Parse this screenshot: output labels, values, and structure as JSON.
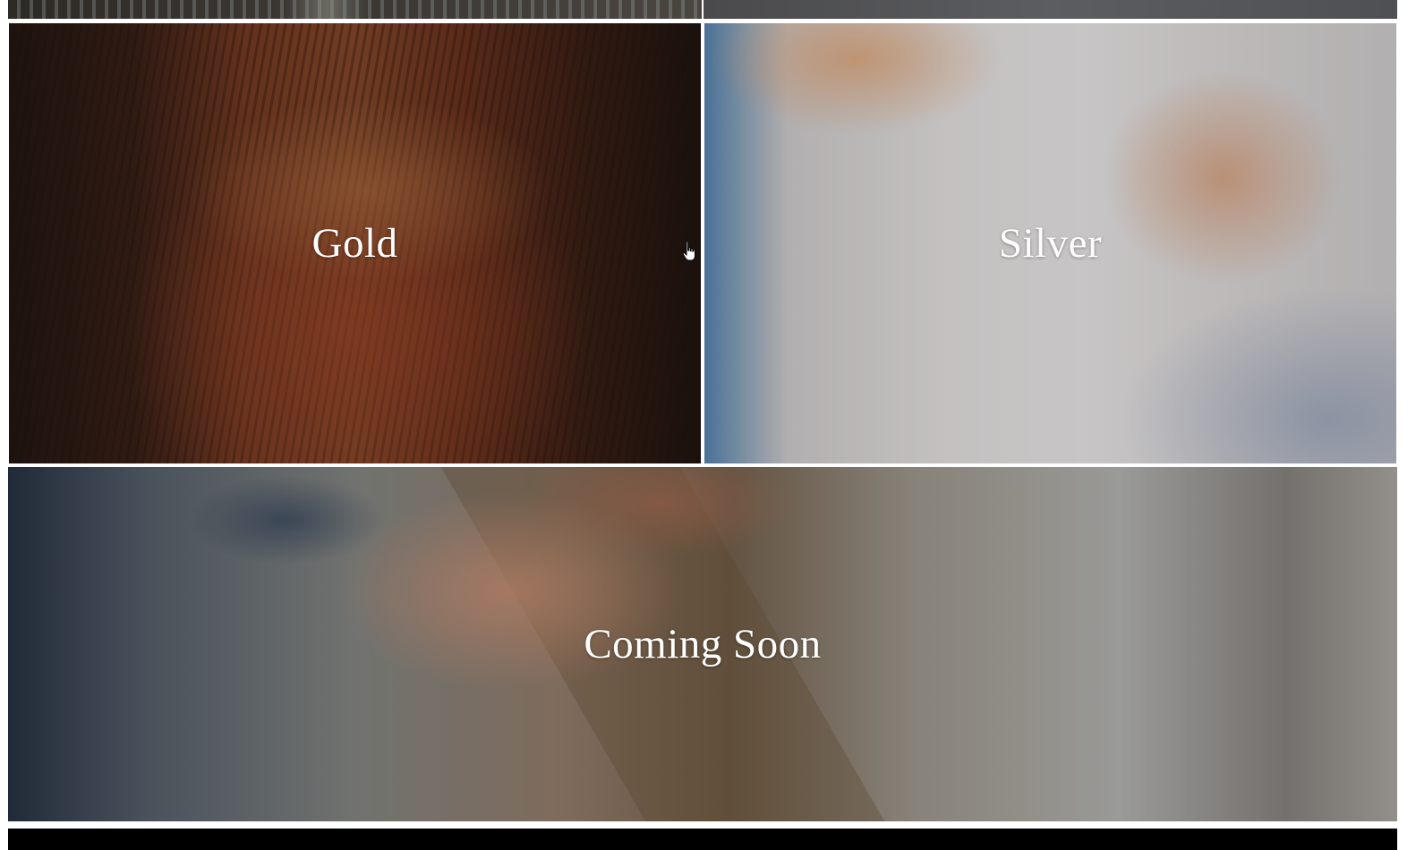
{
  "categories": [
    {
      "id": "gold",
      "label": "Gold"
    },
    {
      "id": "silver",
      "label": "Silver"
    },
    {
      "id": "coming-soon",
      "label": "Coming Soon"
    }
  ],
  "colors": {
    "overlay_text": "#ffffff",
    "background": "#ffffff",
    "footer_bar": "#000000"
  },
  "cursor": {
    "type": "hand-pointer-icon"
  }
}
